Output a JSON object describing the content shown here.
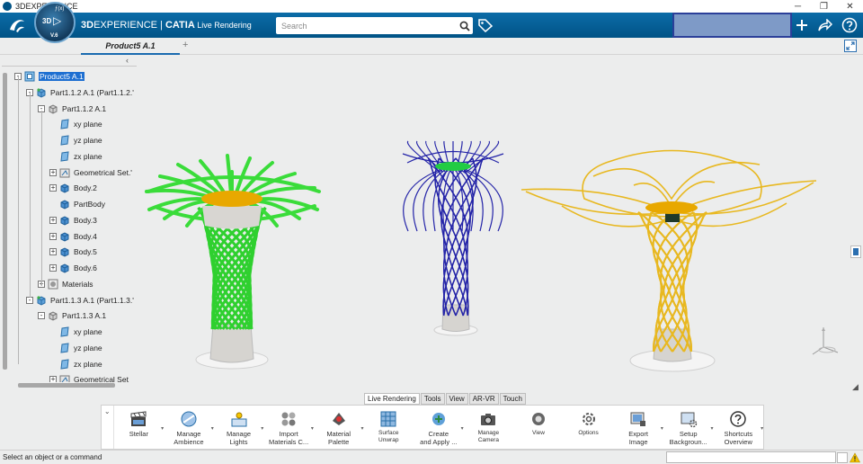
{
  "window": {
    "title": "3DEXPERIENCE",
    "controls": [
      "─",
      "❐",
      "✕"
    ]
  },
  "header": {
    "compass": {
      "top": "3D",
      "version": "V.6",
      "side": "ƒ(x)"
    },
    "brand_bold": "3D",
    "brand_main": "EXPERIENCE",
    "brand_sep": " | ",
    "brand_app": "CATIA",
    "brand_module": " Live Rendering",
    "search_placeholder": "Search"
  },
  "document_tab": {
    "label": "Product5 A.1",
    "add": "+"
  },
  "tree": {
    "items": [
      {
        "label": "Product5 A.1",
        "selected": true
      },
      {
        "label": "Part1.1.2 A.1 (Part1.1.2.'"
      },
      {
        "label": "Part1.1.2 A.1"
      },
      {
        "label": "xy plane"
      },
      {
        "label": "yz plane"
      },
      {
        "label": "zx plane"
      },
      {
        "label": "Geometrical Set.'"
      },
      {
        "label": "Body.2"
      },
      {
        "label": "PartBody"
      },
      {
        "label": "Body.3"
      },
      {
        "label": "Body.4"
      },
      {
        "label": "Body.5"
      },
      {
        "label": "Body.6"
      },
      {
        "label": "Materials"
      },
      {
        "label": "Part1.1.3 A.1 (Part1.1.3.'"
      },
      {
        "label": "Part1.1.3 A.1"
      },
      {
        "label": "xy plane"
      },
      {
        "label": "yz plane"
      },
      {
        "label": "zx plane"
      },
      {
        "label": "Geometrical Set"
      }
    ]
  },
  "actionbar": {
    "tabs": [
      "Live Rendering",
      "Tools",
      "View",
      "AR-VR",
      "Touch"
    ],
    "buttons": [
      {
        "label": "Stellar",
        "icon": "clapperboard-icon"
      },
      {
        "label": "Manage\nAmbience",
        "icon": "ambience-sphere-icon"
      },
      {
        "label": "Manage\nLights",
        "icon": "lights-icon"
      },
      {
        "label": "Import\nMaterials C...",
        "icon": "materials-icon"
      },
      {
        "label": "Material\nPalette",
        "icon": "material-palette-icon"
      },
      {
        "label": "Surface\nUnwrap",
        "icon": "surface-unwrap-icon"
      },
      {
        "label": "Create\nand Apply ...",
        "icon": "create-apply-icon"
      },
      {
        "label": "Manage\nCamera",
        "icon": "camera-icon"
      },
      {
        "label": "View",
        "icon": "view-icon"
      },
      {
        "label": "Options",
        "icon": "gear-icon"
      },
      {
        "label": "Export\nImage",
        "icon": "export-image-icon"
      },
      {
        "label": "Setup\nBackgroun...",
        "icon": "setup-background-icon"
      },
      {
        "label": "Shortcuts\nOverview",
        "icon": "help-icon"
      }
    ]
  },
  "status": {
    "text": "Select an object or a command"
  },
  "colors": {
    "header": "#005386",
    "selection": "#1e6fd1",
    "green": "#33dd33",
    "blue": "#2a2ab0",
    "gold": "#f0c020"
  }
}
